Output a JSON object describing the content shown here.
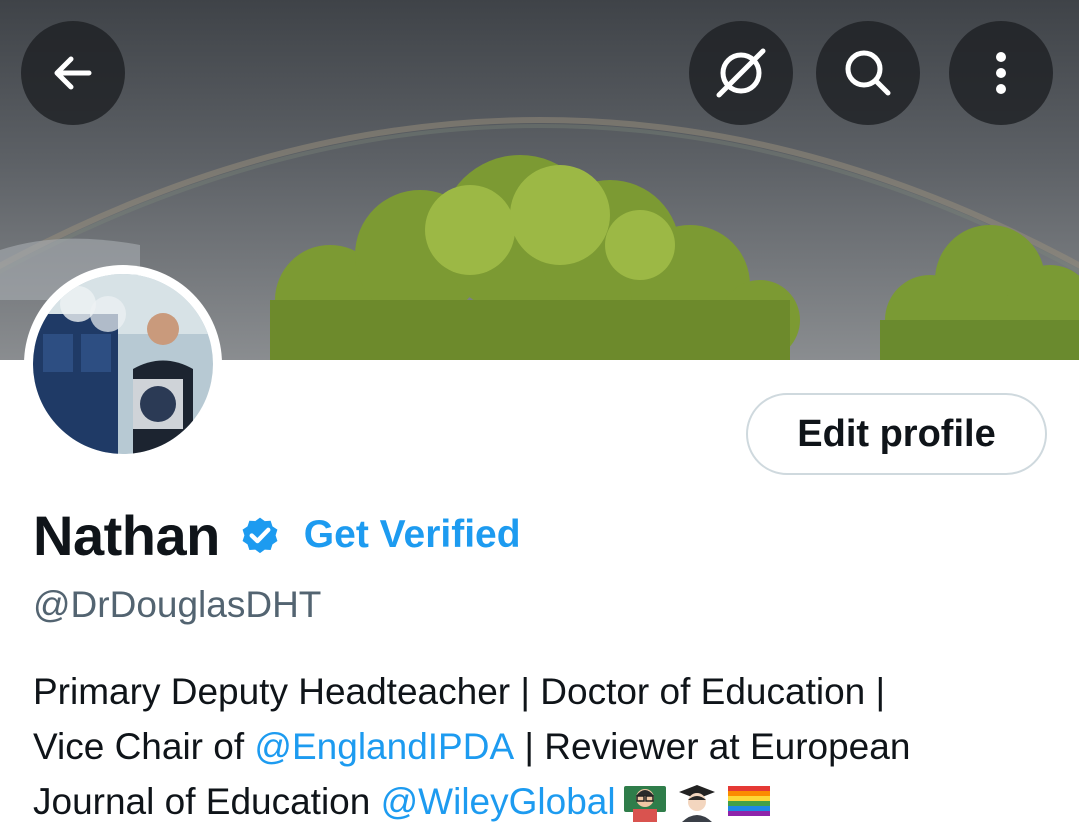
{
  "header": {
    "icons": {
      "back": "arrow-left-icon",
      "grok": "grok-icon",
      "search": "search-icon",
      "more": "more-vertical-icon"
    }
  },
  "profile": {
    "edit_label": "Edit profile",
    "display_name": "Nathan",
    "badge_icon": "verified-badge-icon",
    "get_verified_label": "Get Verified",
    "handle": "@DrDouglasDHT",
    "bio": {
      "line1": "Primary Deputy Headteacher | Doctor of Education |",
      "line2_prefix": "Vice Chair of ",
      "line2_mention": "@EnglandIPDA",
      "line2_suffix": " | Reviewer at European",
      "line3_prefix": "Journal of Education ",
      "line3_mention": "@WileyGlobal",
      "emojis": [
        "teacher-emoji",
        "graduate-emoji",
        "rainbow-flag-emoji"
      ]
    }
  },
  "colors": {
    "accent": "#1d9bf0",
    "secondary_text": "#536471",
    "button_border": "#cfd9de",
    "overlay_button": "#1e2125"
  }
}
